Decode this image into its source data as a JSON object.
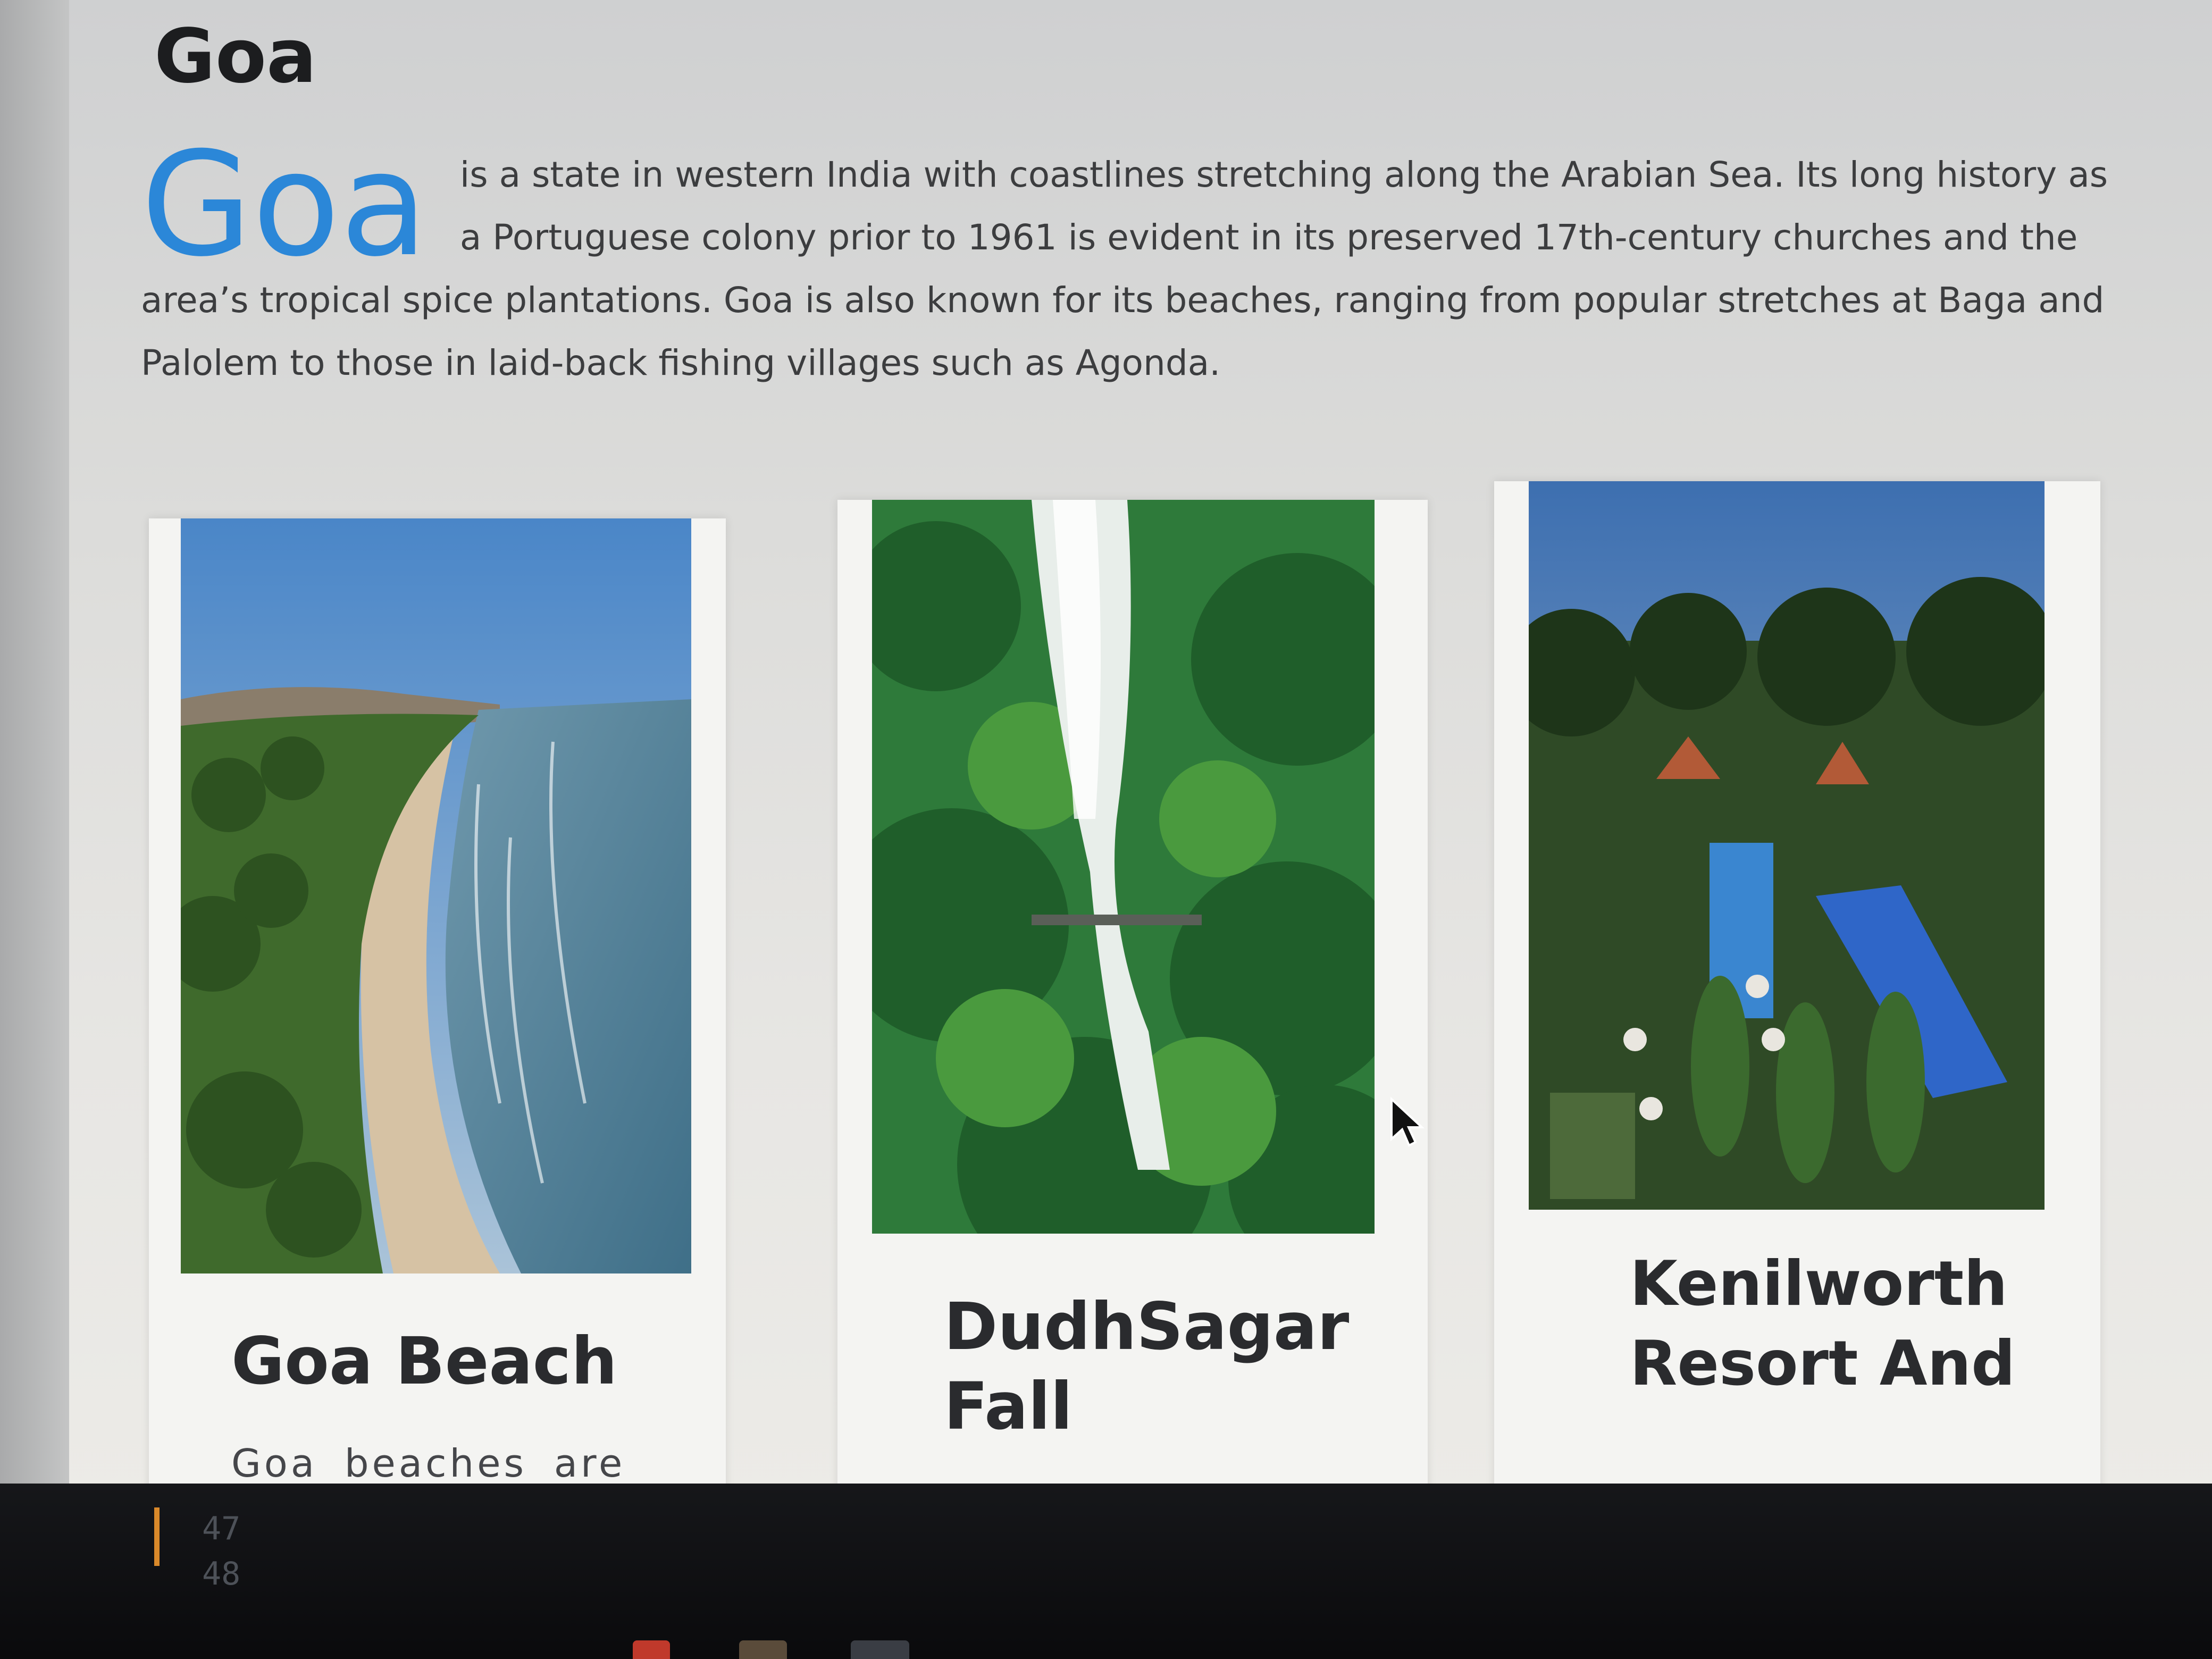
{
  "page": {
    "heading": "Goa",
    "intro_dropcap": "Goa",
    "intro_text": "is a state in western India with coastlines stretching along the Arabian Sea. Its long history as a Portuguese colony prior to 1961 is evident in its preserved 17th-century churches and the area’s tropical spice plantations. Goa is also known for its beaches, ranging from popular stretches at Baga and Palolem to those in laid-back fishing villages such as Agonda."
  },
  "cards": [
    {
      "title": "Goa Beach",
      "text": "Goa beaches are just",
      "image": "beach-photo"
    },
    {
      "title": "DudhSagar Fall",
      "text": "",
      "image": "waterfall-photo"
    },
    {
      "title": "Kenilworth Resort And",
      "text": "",
      "image": "resort-photo"
    }
  ],
  "taskbar": {
    "line_numbers": [
      "47",
      "48"
    ],
    "marker_color": "#d9892a"
  },
  "colors": {
    "accent": "#2b87d8",
    "heading": "#1c1d1f",
    "body_text": "#3c3d3f"
  },
  "icons": [
    "cursor-arrow-icon",
    "taskbar-app-icon"
  ]
}
